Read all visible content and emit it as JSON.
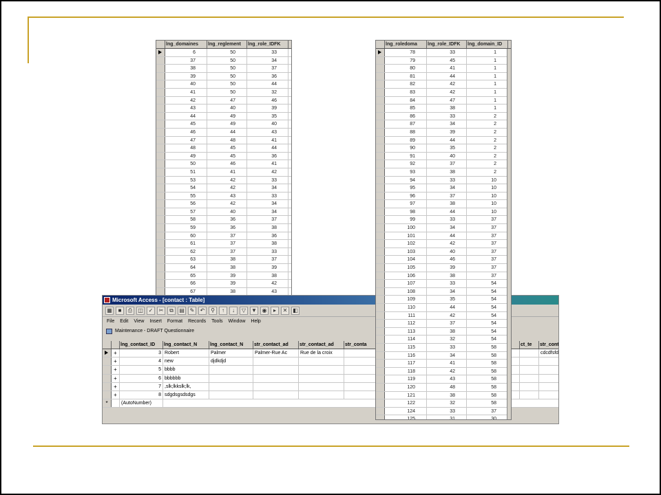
{
  "colors": {
    "rule": "#c9a227",
    "title_bar": "#0a246a",
    "grid_header": "#d4d0c8"
  },
  "grid_left": {
    "headers": [
      "lng_domaines",
      "lng_reglement",
      "lng_role_IDFK"
    ],
    "rows": [
      [
        "6",
        "50",
        "33"
      ],
      [
        "37",
        "50",
        "34"
      ],
      [
        "38",
        "50",
        "37"
      ],
      [
        "39",
        "50",
        "36"
      ],
      [
        "40",
        "50",
        "44"
      ],
      [
        "41",
        "50",
        "32"
      ],
      [
        "42",
        "47",
        "46"
      ],
      [
        "43",
        "40",
        "39"
      ],
      [
        "44",
        "49",
        "35"
      ],
      [
        "45",
        "49",
        "40"
      ],
      [
        "46",
        "44",
        "43"
      ],
      [
        "47",
        "48",
        "41"
      ],
      [
        "48",
        "45",
        "44"
      ],
      [
        "49",
        "45",
        "36"
      ],
      [
        "50",
        "46",
        "41"
      ],
      [
        "51",
        "41",
        "42"
      ],
      [
        "53",
        "42",
        "33"
      ],
      [
        "54",
        "42",
        "34"
      ],
      [
        "55",
        "43",
        "33"
      ],
      [
        "56",
        "42",
        "34"
      ],
      [
        "57",
        "40",
        "34"
      ],
      [
        "58",
        "36",
        "37"
      ],
      [
        "59",
        "36",
        "38"
      ],
      [
        "60",
        "37",
        "36"
      ],
      [
        "61",
        "37",
        "38"
      ],
      [
        "62",
        "37",
        "33"
      ],
      [
        "63",
        "38",
        "37"
      ],
      [
        "64",
        "38",
        "39"
      ],
      [
        "65",
        "39",
        "38"
      ],
      [
        "66",
        "39",
        "42"
      ],
      [
        "67",
        "38",
        "43"
      ]
    ]
  },
  "grid_right": {
    "headers": [
      "lng_roledoma",
      "lng_role_IDFK",
      "lng_domain_ID"
    ],
    "rows": [
      [
        "78",
        "33",
        "1"
      ],
      [
        "79",
        "45",
        "1"
      ],
      [
        "80",
        "41",
        "1"
      ],
      [
        "81",
        "44",
        "1"
      ],
      [
        "82",
        "42",
        "1"
      ],
      [
        "83",
        "42",
        "1"
      ],
      [
        "84",
        "47",
        "1"
      ],
      [
        "85",
        "38",
        "1"
      ],
      [
        "86",
        "33",
        "2"
      ],
      [
        "87",
        "34",
        "2"
      ],
      [
        "88",
        "39",
        "2"
      ],
      [
        "89",
        "44",
        "2"
      ],
      [
        "90",
        "35",
        "2"
      ],
      [
        "91",
        "40",
        "2"
      ],
      [
        "92",
        "37",
        "2"
      ],
      [
        "93",
        "38",
        "2"
      ],
      [
        "94",
        "33",
        "10"
      ],
      [
        "95",
        "34",
        "10"
      ],
      [
        "96",
        "37",
        "10"
      ],
      [
        "97",
        "38",
        "10"
      ],
      [
        "98",
        "44",
        "10"
      ],
      [
        "99",
        "33",
        "37"
      ],
      [
        "100",
        "34",
        "37"
      ],
      [
        "101",
        "44",
        "37"
      ],
      [
        "102",
        "42",
        "37"
      ],
      [
        "103",
        "40",
        "37"
      ],
      [
        "104",
        "46",
        "37"
      ],
      [
        "105",
        "39",
        "37"
      ],
      [
        "106",
        "38",
        "37"
      ],
      [
        "107",
        "33",
        "54"
      ],
      [
        "108",
        "34",
        "54"
      ],
      [
        "109",
        "35",
        "54"
      ],
      [
        "110",
        "44",
        "54"
      ],
      [
        "111",
        "42",
        "54"
      ],
      [
        "112",
        "37",
        "54"
      ],
      [
        "113",
        "38",
        "54"
      ],
      [
        "114",
        "32",
        "54"
      ],
      [
        "115",
        "33",
        "58"
      ],
      [
        "116",
        "34",
        "58"
      ],
      [
        "117",
        "41",
        "58"
      ],
      [
        "118",
        "42",
        "58"
      ],
      [
        "119",
        "43",
        "58"
      ],
      [
        "120",
        "48",
        "58"
      ],
      [
        "121",
        "38",
        "58"
      ],
      [
        "122",
        "32",
        "58"
      ],
      [
        "124",
        "33",
        "37"
      ],
      [
        "125",
        "31",
        "30"
      ]
    ]
  },
  "access": {
    "title": "Microsoft Access - [contact : Table]",
    "menu": [
      "File",
      "Edit",
      "View",
      "Insert",
      "Format",
      "Records",
      "Tools",
      "Window",
      "Help"
    ],
    "db_bar": "Maintenance - DRAFT Questionnaire",
    "headers": [
      "lng_contact_ID",
      "lng_contact_N",
      "lng_contact_N",
      "str_contact_ad",
      "str_contact_ad",
      "str_conta",
      "ct_te",
      "str_conta"
    ],
    "rows": [
      {
        "id": "3",
        "c1": "Robert",
        "c2": "Palmer",
        "c3": "Palmer-Rue Ac",
        "c4": "Rue de la croix",
        "c9": "cdcdfsfdd"
      },
      {
        "id": "4",
        "c1": "new",
        "c2": "djdkdjd",
        "c3": "",
        "c4": "",
        "c9": ""
      },
      {
        "id": "5",
        "c1": "bbbb",
        "c2": "",
        "c3": "",
        "c4": "",
        "c9": ""
      },
      {
        "id": "6",
        "c1": "bbbbbb",
        "c2": "",
        "c3": "",
        "c4": "",
        "c9": ""
      },
      {
        "id": "7",
        "c1": ",slk;lkkslk;lk,",
        "c2": "",
        "c3": "",
        "c4": "",
        "c9": ""
      },
      {
        "id": "8",
        "c1": "sdgdsgsdsdgs",
        "c2": "",
        "c3": "",
        "c4": "",
        "c9": ""
      }
    ],
    "new_row": "(AutoNumber)"
  }
}
